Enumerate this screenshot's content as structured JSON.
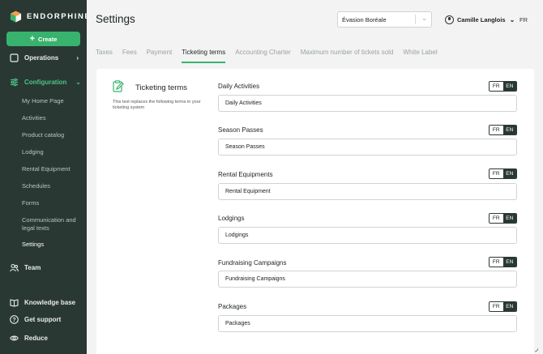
{
  "sidebar": {
    "brand": "ENDORPHINE",
    "create_label": "Create",
    "operations_label": "Operations",
    "configuration_label": "Configuration",
    "config_items": [
      "My Home Page",
      "Activities",
      "Product catalog",
      "Lodging",
      "Rental Equipment",
      "Schedules",
      "Forms",
      "Communication and legal texts",
      "Settings"
    ],
    "active_item": "Settings",
    "team_label": "Team",
    "knowledge_label": "Knowledge base",
    "support_label": "Get support",
    "reduce_label": "Reduce",
    "accent": "#38b36d",
    "background": "#2a3833"
  },
  "header": {
    "title": "Settings",
    "organization": "Évasion Boréale",
    "user": "Camille Langlois",
    "language": "FR"
  },
  "tabs": [
    "Taxes",
    "Fees",
    "Payment",
    "Ticketing terms",
    "Accounting Charter",
    "Maximum number of tickets sold",
    "White Label"
  ],
  "active_tab": "Ticketing terms",
  "section": {
    "title": "Ticketing terms",
    "description": "This text replaces the following terms in your ticketing system",
    "icon": "clipboard-edit-icon"
  },
  "lang_toggle": {
    "fr": "FR",
    "en": "EN",
    "selected": "EN"
  },
  "fields": [
    {
      "label": "Daily Activities",
      "value": "Daily Activities"
    },
    {
      "label": "Season Passes",
      "value": "Season Passes"
    },
    {
      "label": "Rental Equipments",
      "value": "Rental Equipment"
    },
    {
      "label": "Lodgings",
      "value": "Lodgings"
    },
    {
      "label": "Fundraising Campaigns",
      "value": "Fundraising Campaigns"
    },
    {
      "label": "Packages",
      "value": "Packages"
    }
  ]
}
